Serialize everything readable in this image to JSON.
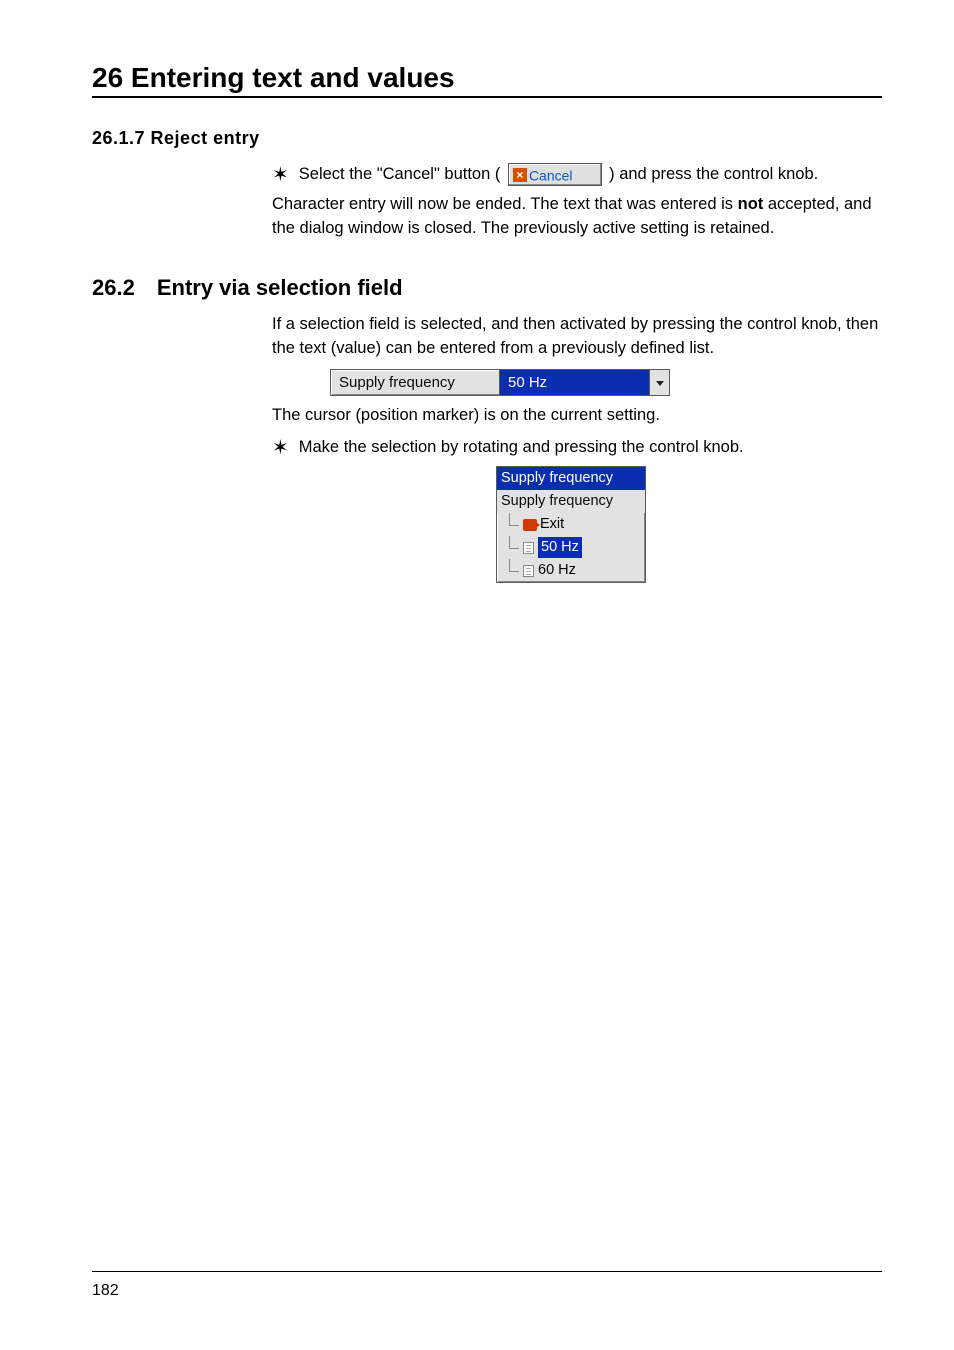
{
  "chapter": {
    "title": "26 Entering text and values"
  },
  "section_2617": {
    "heading": "26.1.7  Reject entry",
    "step_pre": "Select the \"Cancel\" button (",
    "step_post": ") and press the control knob.",
    "cancel_button_label": "Cancel",
    "para": "Character entry will now be ended. The text that was entered is ",
    "para_bold": "not",
    "para_end": " accepted, and the dialog window is closed. The previously active setting is retained."
  },
  "section_262": {
    "number": "26.2",
    "title": "Entry via selection field",
    "intro": "If a selection field is selected, and then activated by pressing the control knob, then the text (value) can be entered from a previously defined list.",
    "select_field": {
      "label": "Supply frequency",
      "value": "50 Hz"
    },
    "cursor_note": "The cursor (position marker) is on the current setting.",
    "step": "Make the selection by rotating and pressing the control knob.",
    "dropdown": {
      "header": "Supply frequency",
      "subheader": "Supply frequency",
      "options": {
        "exit": "Exit",
        "opt1": "50 Hz",
        "opt2": "60 Hz"
      }
    }
  },
  "page_number": "182"
}
